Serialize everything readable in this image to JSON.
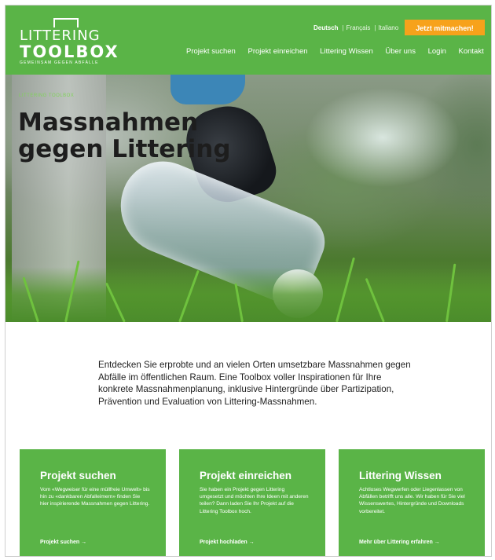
{
  "header": {
    "logo": {
      "line1": "LITTERING",
      "line2": "TOOLBOX",
      "tagline": "gemeinsam gegen abfälle"
    },
    "languages": [
      {
        "label": "Deutsch",
        "active": true
      },
      {
        "label": "Français",
        "active": false
      },
      {
        "label": "Italiano",
        "active": false
      }
    ],
    "cta": "Jetzt mitmachen!",
    "nav": [
      "Projekt suchen",
      "Projekt einreichen",
      "Littering Wissen",
      "Über uns",
      "Login",
      "Kontakt"
    ]
  },
  "hero": {
    "kicker": "Littering Toolbox",
    "title_line1": "Massnahmen",
    "title_line2": "gegen Littering"
  },
  "intro": "Entdecken Sie erprobte und an vielen Orten umsetzbare Massnahmen gegen Abfälle im öffentlichen Raum. Eine Toolbox voller Inspirationen für Ihre konkrete Massnahmenplanung, inklusive Hintergründe über Partizipation, Prävention und Evaluation von Littering-Massnahmen.",
  "cards": [
    {
      "title": "Projekt suchen",
      "text": "Vom «Wegweiser für eine müllfreie Umwelt» bis hin zu «dankbaren Abfalleimern» finden Sie hier inspirierende Massnahmen gegen Littering.",
      "link": "Projekt suchen →"
    },
    {
      "title": "Projekt einreichen",
      "text": "Sie haben ein Projekt gegen Littering umgesetzt und möchten Ihre Ideen mit anderen teilen? Dann laden Sie Ihr Projekt auf die Littering Toolbox hoch.",
      "link": "Projekt hochladen →"
    },
    {
      "title": "Littering Wissen",
      "text": "Achtloses Wegwerfen oder Liegenlassen von Abfällen betrifft uns alle. Wir haben für Sie viel Wissenswertes, Hintergründe und Downloads vorbereitet.",
      "link": "Mehr über Littering erfahren →"
    }
  ],
  "colors": {
    "brand_green": "#5ab447",
    "accent_orange": "#f7a21b"
  }
}
